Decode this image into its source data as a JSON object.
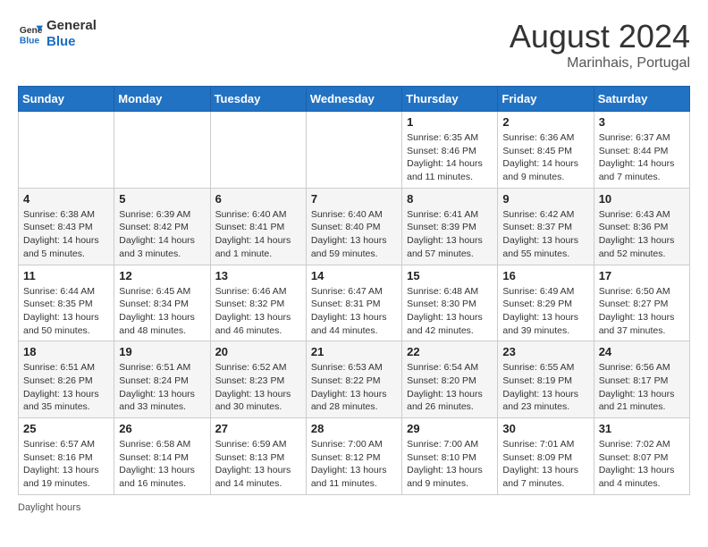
{
  "header": {
    "logo_line1": "General",
    "logo_line2": "Blue",
    "month_year": "August 2024",
    "location": "Marinhais, Portugal"
  },
  "calendar": {
    "days_of_week": [
      "Sunday",
      "Monday",
      "Tuesday",
      "Wednesday",
      "Thursday",
      "Friday",
      "Saturday"
    ],
    "weeks": [
      [
        {
          "day": "",
          "info": ""
        },
        {
          "day": "",
          "info": ""
        },
        {
          "day": "",
          "info": ""
        },
        {
          "day": "",
          "info": ""
        },
        {
          "day": "1",
          "info": "Sunrise: 6:35 AM\nSunset: 8:46 PM\nDaylight: 14 hours\nand 11 minutes."
        },
        {
          "day": "2",
          "info": "Sunrise: 6:36 AM\nSunset: 8:45 PM\nDaylight: 14 hours\nand 9 minutes."
        },
        {
          "day": "3",
          "info": "Sunrise: 6:37 AM\nSunset: 8:44 PM\nDaylight: 14 hours\nand 7 minutes."
        }
      ],
      [
        {
          "day": "4",
          "info": "Sunrise: 6:38 AM\nSunset: 8:43 PM\nDaylight: 14 hours\nand 5 minutes."
        },
        {
          "day": "5",
          "info": "Sunrise: 6:39 AM\nSunset: 8:42 PM\nDaylight: 14 hours\nand 3 minutes."
        },
        {
          "day": "6",
          "info": "Sunrise: 6:40 AM\nSunset: 8:41 PM\nDaylight: 14 hours\nand 1 minute."
        },
        {
          "day": "7",
          "info": "Sunrise: 6:40 AM\nSunset: 8:40 PM\nDaylight: 13 hours\nand 59 minutes."
        },
        {
          "day": "8",
          "info": "Sunrise: 6:41 AM\nSunset: 8:39 PM\nDaylight: 13 hours\nand 57 minutes."
        },
        {
          "day": "9",
          "info": "Sunrise: 6:42 AM\nSunset: 8:37 PM\nDaylight: 13 hours\nand 55 minutes."
        },
        {
          "day": "10",
          "info": "Sunrise: 6:43 AM\nSunset: 8:36 PM\nDaylight: 13 hours\nand 52 minutes."
        }
      ],
      [
        {
          "day": "11",
          "info": "Sunrise: 6:44 AM\nSunset: 8:35 PM\nDaylight: 13 hours\nand 50 minutes."
        },
        {
          "day": "12",
          "info": "Sunrise: 6:45 AM\nSunset: 8:34 PM\nDaylight: 13 hours\nand 48 minutes."
        },
        {
          "day": "13",
          "info": "Sunrise: 6:46 AM\nSunset: 8:32 PM\nDaylight: 13 hours\nand 46 minutes."
        },
        {
          "day": "14",
          "info": "Sunrise: 6:47 AM\nSunset: 8:31 PM\nDaylight: 13 hours\nand 44 minutes."
        },
        {
          "day": "15",
          "info": "Sunrise: 6:48 AM\nSunset: 8:30 PM\nDaylight: 13 hours\nand 42 minutes."
        },
        {
          "day": "16",
          "info": "Sunrise: 6:49 AM\nSunset: 8:29 PM\nDaylight: 13 hours\nand 39 minutes."
        },
        {
          "day": "17",
          "info": "Sunrise: 6:50 AM\nSunset: 8:27 PM\nDaylight: 13 hours\nand 37 minutes."
        }
      ],
      [
        {
          "day": "18",
          "info": "Sunrise: 6:51 AM\nSunset: 8:26 PM\nDaylight: 13 hours\nand 35 minutes."
        },
        {
          "day": "19",
          "info": "Sunrise: 6:51 AM\nSunset: 8:24 PM\nDaylight: 13 hours\nand 33 minutes."
        },
        {
          "day": "20",
          "info": "Sunrise: 6:52 AM\nSunset: 8:23 PM\nDaylight: 13 hours\nand 30 minutes."
        },
        {
          "day": "21",
          "info": "Sunrise: 6:53 AM\nSunset: 8:22 PM\nDaylight: 13 hours\nand 28 minutes."
        },
        {
          "day": "22",
          "info": "Sunrise: 6:54 AM\nSunset: 8:20 PM\nDaylight: 13 hours\nand 26 minutes."
        },
        {
          "day": "23",
          "info": "Sunrise: 6:55 AM\nSunset: 8:19 PM\nDaylight: 13 hours\nand 23 minutes."
        },
        {
          "day": "24",
          "info": "Sunrise: 6:56 AM\nSunset: 8:17 PM\nDaylight: 13 hours\nand 21 minutes."
        }
      ],
      [
        {
          "day": "25",
          "info": "Sunrise: 6:57 AM\nSunset: 8:16 PM\nDaylight: 13 hours\nand 19 minutes."
        },
        {
          "day": "26",
          "info": "Sunrise: 6:58 AM\nSunset: 8:14 PM\nDaylight: 13 hours\nand 16 minutes."
        },
        {
          "day": "27",
          "info": "Sunrise: 6:59 AM\nSunset: 8:13 PM\nDaylight: 13 hours\nand 14 minutes."
        },
        {
          "day": "28",
          "info": "Sunrise: 7:00 AM\nSunset: 8:12 PM\nDaylight: 13 hours\nand 11 minutes."
        },
        {
          "day": "29",
          "info": "Sunrise: 7:00 AM\nSunset: 8:10 PM\nDaylight: 13 hours\nand 9 minutes."
        },
        {
          "day": "30",
          "info": "Sunrise: 7:01 AM\nSunset: 8:09 PM\nDaylight: 13 hours\nand 7 minutes."
        },
        {
          "day": "31",
          "info": "Sunrise: 7:02 AM\nSunset: 8:07 PM\nDaylight: 13 hours\nand 4 minutes."
        }
      ]
    ]
  },
  "footer": {
    "daylight_label": "Daylight hours"
  }
}
